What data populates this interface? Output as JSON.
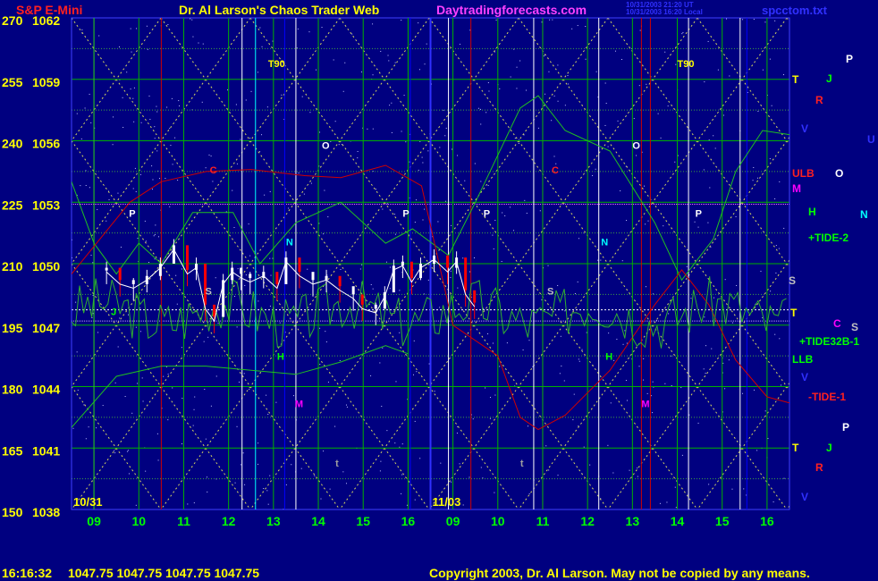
{
  "header": {
    "instrument": "S&P E-Mini",
    "title": "Dr. Al Larson's Chaos Trader Web",
    "site": "Daytradingforecasts.com",
    "stamp1": "10/31/2003 21:20 UT",
    "stamp2": "10/31/2003 16:20 Local",
    "filename": "spcctom.txt"
  },
  "footer": {
    "time": "16:16:32",
    "quotes": "1047.75 1047.75 1047.75 1047.75",
    "copyright": "Copyright 2003, Dr. Al Larson. May not be copied by any means."
  },
  "colors": {
    "background": "#000080",
    "grid_green": "#00b000",
    "price_white": "#ffffff",
    "price_red": "#ff0000",
    "tide_red": "#d00000",
    "tide_green": "#20c020",
    "diag_yellow": "#d8d860",
    "label_yellow": "#ffff00",
    "label_green": "#00ff00",
    "label_cyan": "#00ffff",
    "label_magenta": "#ff00ff",
    "label_blue": "#3030ff",
    "label_red": "#ff2020"
  },
  "chart_data": {
    "type": "line",
    "title": "S&P E-Mini",
    "y_labels_outer": [
      "270",
      "255",
      "240",
      "225",
      "210",
      "195",
      "180",
      "165",
      "150"
    ],
    "y_labels_price": [
      "1062",
      "1059",
      "1056",
      "1053",
      "1050",
      "1047",
      "1044",
      "1041",
      "1038"
    ],
    "ylim": [
      1038,
      1062
    ],
    "x_ticks": [
      "09",
      "10",
      "11",
      "12",
      "13",
      "14",
      "15",
      "16",
      "09",
      "10",
      "11",
      "12",
      "13",
      "14",
      "15",
      "16"
    ],
    "date_labels": [
      "10/31",
      "11/03"
    ],
    "price_series": {
      "name": "S&P E-Mini",
      "x": [
        8.0,
        8.3,
        8.6,
        8.9,
        9.2,
        9.5,
        9.8,
        10.0,
        10.2,
        10.4,
        10.6,
        10.8,
        11.0,
        11.2,
        11.5,
        11.8,
        12.0,
        12.3,
        12.6,
        12.9,
        13.2,
        13.5,
        13.7,
        14.0,
        14.2,
        14.4,
        14.6,
        14.8,
        15.0,
        15.3,
        15.6,
        15.8,
        16.0,
        16.2
      ],
      "y": [
        1049.6,
        1049.0,
        1048.8,
        1049.2,
        1049.8,
        1050.7,
        1049.5,
        1049.8,
        1047.8,
        1047.2,
        1049.0,
        1049.6,
        1049.3,
        1049.1,
        1049.4,
        1048.8,
        1050.1,
        1049.4,
        1049.0,
        1049.2,
        1048.7,
        1048.3,
        1047.8,
        1047.6,
        1048.4,
        1049.7,
        1049.9,
        1049.1,
        1049.8,
        1050.2,
        1049.6,
        1050.1,
        1048.5,
        1047.9
      ]
    },
    "annotations": [
      {
        "text": "T90",
        "x": 11.6,
        "y": 1059.6,
        "color": "#ffff00"
      },
      {
        "text": "T90",
        "x": 22.0,
        "y": 1059.6,
        "color": "#ffff00"
      },
      {
        "text": "C",
        "x": 10.3,
        "y": 1054.4,
        "color": "#ff2020"
      },
      {
        "text": "C",
        "x": 19.2,
        "y": 1054.4,
        "color": "#ff2020"
      },
      {
        "text": "O",
        "x": 12.8,
        "y": 1055.6,
        "color": "#ffffff"
      },
      {
        "text": "O",
        "x": 21.0,
        "y": 1055.6,
        "color": "#ffffff"
      },
      {
        "text": "P",
        "x": 8.5,
        "y": 1052.3,
        "color": "#ffffff"
      },
      {
        "text": "P",
        "x": 14.6,
        "y": 1052.3,
        "color": "#ffffff"
      },
      {
        "text": "P",
        "x": 16.4,
        "y": 1052.3,
        "color": "#ffffff"
      },
      {
        "text": "P",
        "x": 22.4,
        "y": 1052.3,
        "color": "#ffffff"
      },
      {
        "text": "N",
        "x": 12.0,
        "y": 1050.9,
        "color": "#00ffff"
      },
      {
        "text": "N",
        "x": 20.3,
        "y": 1050.9,
        "color": "#00ffff"
      },
      {
        "text": "S",
        "x": 10.2,
        "y": 1048.5,
        "color": "#c0c0c0"
      },
      {
        "text": "S",
        "x": 19.1,
        "y": 1048.5,
        "color": "#c0c0c0"
      },
      {
        "text": "J",
        "x": 8.1,
        "y": 1047.5,
        "color": "#00ff00"
      },
      {
        "text": "H",
        "x": 11.8,
        "y": 1045.3,
        "color": "#00ff00"
      },
      {
        "text": "H",
        "x": 20.4,
        "y": 1045.3,
        "color": "#00ff00"
      },
      {
        "text": "M",
        "x": 12.2,
        "y": 1043.0,
        "color": "#ff00ff"
      },
      {
        "text": "M",
        "x": 21.2,
        "y": 1043.0,
        "color": "#ff00ff"
      },
      {
        "text": "t",
        "x": 13.1,
        "y": 1040.1,
        "color": "#a0a0a0"
      },
      {
        "text": "t",
        "x": 18.5,
        "y": 1040.1,
        "color": "#a0a0a0"
      }
    ],
    "legend": {
      "placement": "right",
      "items": [
        {
          "text": "P",
          "color": "#ffffff"
        },
        {
          "text": "T",
          "color": "#ffff00"
        },
        {
          "text": "J",
          "color": "#00ff00"
        },
        {
          "text": "R",
          "color": "#ff2020"
        },
        {
          "text": "V",
          "color": "#3030ff"
        },
        {
          "text": "U",
          "color": "#3030ff"
        },
        {
          "text": "ULB",
          "color": "#ff2020"
        },
        {
          "text": "O",
          "color": "#ffffff"
        },
        {
          "text": "M",
          "color": "#ff00ff"
        },
        {
          "text": "H",
          "color": "#00ff00"
        },
        {
          "text": "N",
          "color": "#00ffff"
        },
        {
          "text": "+TIDE-2",
          "color": "#00ff00"
        },
        {
          "text": "S",
          "color": "#c0c0c0"
        },
        {
          "text": "T",
          "color": "#ffff00"
        },
        {
          "text": "C",
          "color": "#ff00ff"
        },
        {
          "text": "S",
          "color": "#c0c0c0"
        },
        {
          "text": "+TIDE32B-1",
          "color": "#00ff00"
        },
        {
          "text": "LLB",
          "color": "#00ff00"
        },
        {
          "text": "V",
          "color": "#3030ff"
        },
        {
          "text": "-TIDE-1",
          "color": "#ff2020"
        },
        {
          "text": "P",
          "color": "#ffffff"
        },
        {
          "text": "T",
          "color": "#ffff00"
        },
        {
          "text": "J",
          "color": "#00ff00"
        },
        {
          "text": "R",
          "color": "#ff2020"
        },
        {
          "text": "V",
          "color": "#3030ff"
        }
      ]
    },
    "grid": true
  }
}
